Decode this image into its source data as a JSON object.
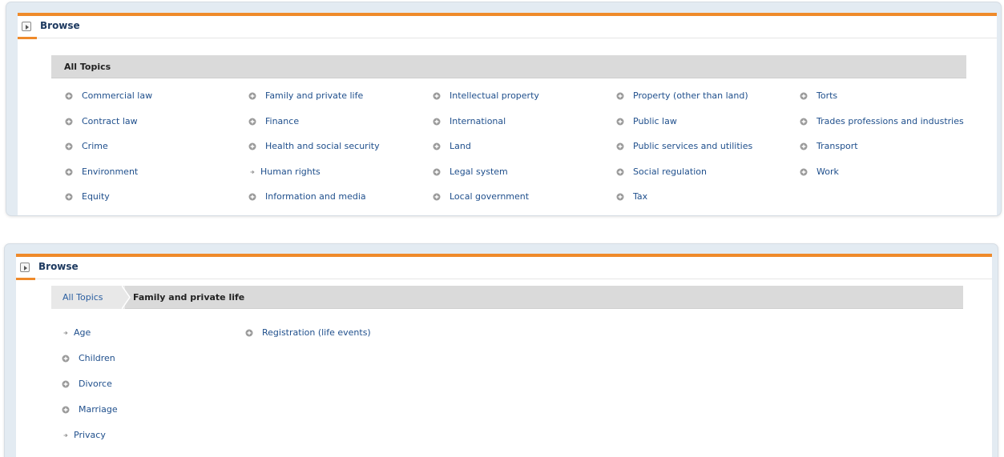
{
  "panel1": {
    "title": "Browse",
    "crumb_current": "All Topics",
    "topics": [
      {
        "label": "Commercial law",
        "icon": "circle-plus-icon"
      },
      {
        "label": "Contract law",
        "icon": "circle-plus-icon"
      },
      {
        "label": "Crime",
        "icon": "circle-plus-icon"
      },
      {
        "label": "Environment",
        "icon": "circle-plus-icon"
      },
      {
        "label": "Equity",
        "icon": "circle-plus-icon"
      },
      {
        "label": "Family and private life",
        "icon": "circle-plus-icon"
      },
      {
        "label": "Finance",
        "icon": "circle-plus-icon"
      },
      {
        "label": "Health and social security",
        "icon": "circle-plus-icon"
      },
      {
        "label": "Human rights",
        "icon": "small-arrow-icon"
      },
      {
        "label": "Information and media",
        "icon": "circle-plus-icon"
      },
      {
        "label": "Intellectual property",
        "icon": "circle-plus-icon"
      },
      {
        "label": "International",
        "icon": "circle-plus-icon"
      },
      {
        "label": "Land",
        "icon": "circle-plus-icon"
      },
      {
        "label": "Legal system",
        "icon": "circle-plus-icon"
      },
      {
        "label": "Local government",
        "icon": "circle-plus-icon"
      },
      {
        "label": "Property (other than land)",
        "icon": "circle-plus-icon"
      },
      {
        "label": "Public law",
        "icon": "circle-plus-icon"
      },
      {
        "label": "Public services and utilities",
        "icon": "circle-plus-icon"
      },
      {
        "label": "Social regulation",
        "icon": "circle-plus-icon"
      },
      {
        "label": "Tax",
        "icon": "circle-plus-icon"
      },
      {
        "label": "Torts",
        "icon": "circle-plus-icon"
      },
      {
        "label": "Trades professions and industries",
        "icon": "circle-plus-icon"
      },
      {
        "label": "Transport",
        "icon": "circle-plus-icon"
      },
      {
        "label": "Work",
        "icon": "circle-plus-icon"
      }
    ]
  },
  "panel2": {
    "title": "Browse",
    "crumb_link": "All Topics",
    "crumb_current": "Family and private life",
    "topics": [
      {
        "label": "Age",
        "icon": "small-arrow-icon"
      },
      {
        "label": "Children",
        "icon": "circle-plus-icon"
      },
      {
        "label": "Divorce",
        "icon": "circle-plus-icon"
      },
      {
        "label": "Marriage",
        "icon": "circle-plus-icon"
      },
      {
        "label": "Privacy",
        "icon": "small-arrow-icon"
      },
      {
        "label": "Registration (life events)",
        "icon": "circle-plus-icon"
      }
    ]
  },
  "colors": {
    "accent": "#ef8a2a",
    "link": "#1f4f8c",
    "crumb_bg": "#dadada"
  }
}
